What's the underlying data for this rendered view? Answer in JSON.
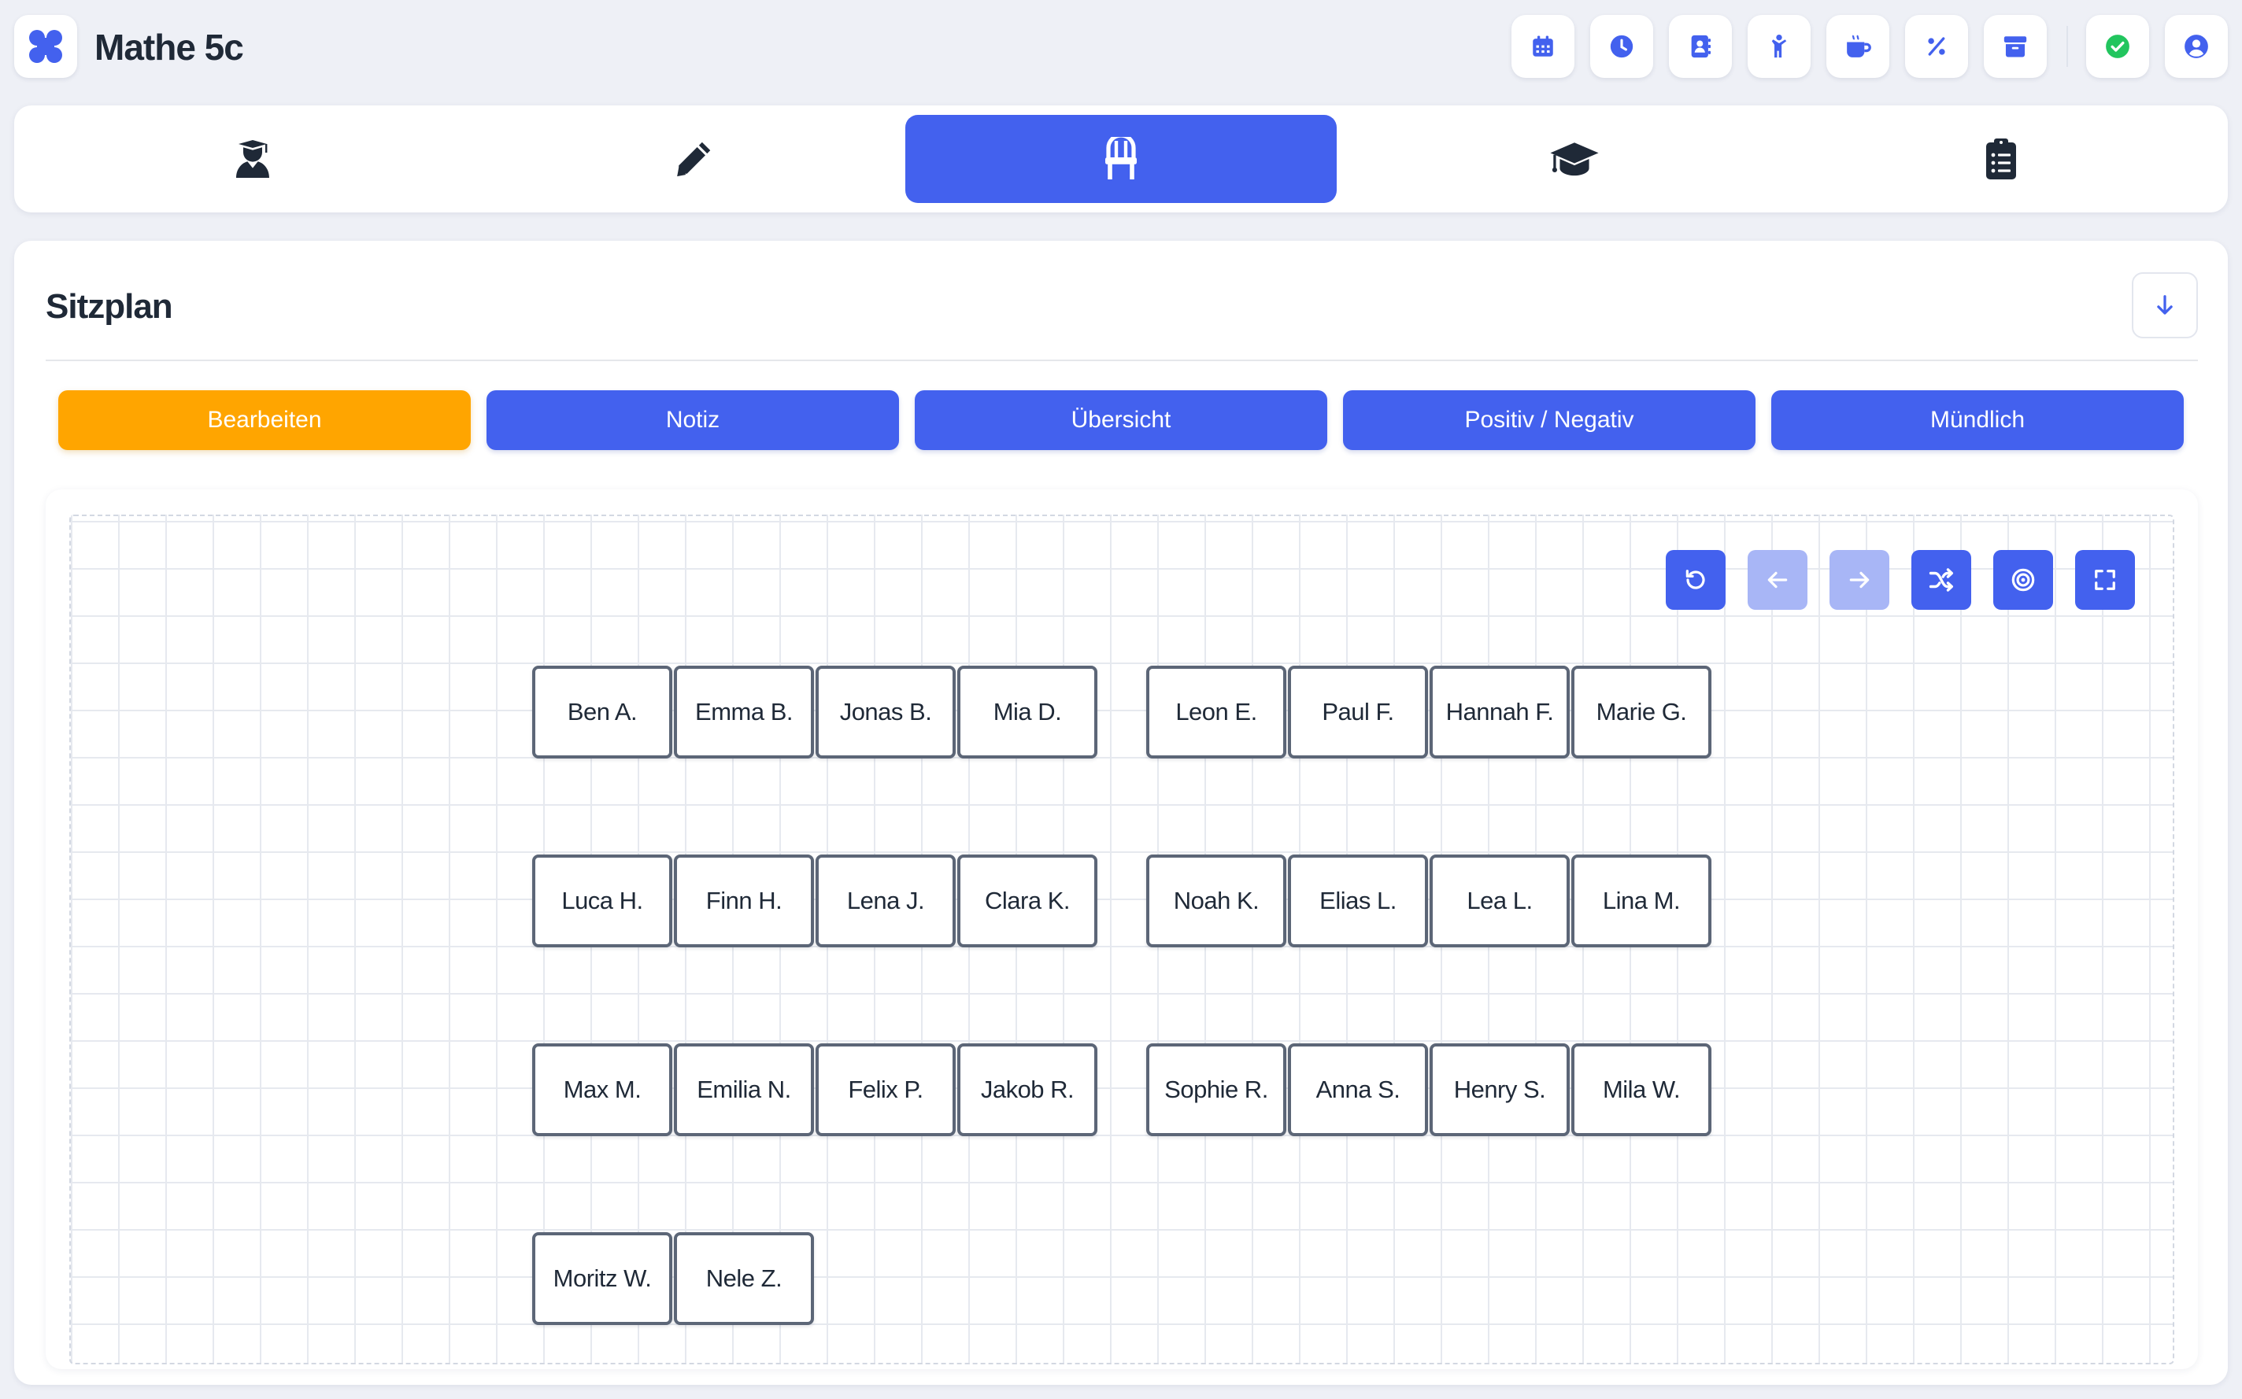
{
  "app": {
    "title": "Mathe 5c"
  },
  "header_buttons": [
    {
      "name": "calendar-button",
      "icon": "calendar-icon"
    },
    {
      "name": "clock-button",
      "icon": "clock-icon"
    },
    {
      "name": "contacts-button",
      "icon": "address-book-icon"
    },
    {
      "name": "child-button",
      "icon": "child-icon"
    },
    {
      "name": "break-button",
      "icon": "coffee-mug-icon"
    },
    {
      "name": "percent-button",
      "icon": "percent-icon"
    },
    {
      "name": "archive-button",
      "icon": "archive-icon"
    },
    {
      "name": "status-button",
      "icon": "check-circle-icon",
      "color": "#22c55e"
    },
    {
      "name": "account-button",
      "icon": "user-circle-icon"
    }
  ],
  "nav_tabs": [
    {
      "icon": "teacher-icon",
      "active": false
    },
    {
      "icon": "pencil-icon",
      "active": false
    },
    {
      "icon": "chair-icon",
      "active": true
    },
    {
      "icon": "graduation-cap-icon",
      "active": false
    },
    {
      "icon": "clipboard-list-icon",
      "active": false
    }
  ],
  "page": {
    "title": "Sitzplan"
  },
  "modes": [
    {
      "label": "Bearbeiten",
      "active": true
    },
    {
      "label": "Notiz",
      "active": false
    },
    {
      "label": "Übersicht",
      "active": false
    },
    {
      "label": "Positiv / Negativ",
      "active": false
    },
    {
      "label": "Mündlich",
      "active": false
    }
  ],
  "toolbar": [
    {
      "name": "reset-button",
      "icon": "rotate-ccw-icon",
      "enabled": true
    },
    {
      "name": "undo-button",
      "icon": "arrow-left-icon",
      "enabled": false
    },
    {
      "name": "redo-button",
      "icon": "arrow-right-icon",
      "enabled": false
    },
    {
      "name": "shuffle-button",
      "icon": "shuffle-icon",
      "enabled": true
    },
    {
      "name": "target-button",
      "icon": "target-icon",
      "enabled": true
    },
    {
      "name": "fullscreen-button",
      "icon": "expand-icon",
      "enabled": true
    }
  ],
  "seat_rows": [
    [
      "Ben A.",
      "Emma B.",
      "Jonas B.",
      "Mia D.",
      "Leon E.",
      "Paul F.",
      "Hannah F.",
      "Marie G."
    ],
    [
      "Luca H.",
      "Finn H.",
      "Lena J.",
      "Clara K.",
      "Noah K.",
      "Elias L.",
      "Lea L.",
      "Lina M."
    ],
    [
      "Max M.",
      "Emilia N.",
      "Felix P.",
      "Jakob R.",
      "Sophie R.",
      "Anna S.",
      "Henry S.",
      "Mila W."
    ],
    [
      "Moritz W.",
      "Nele Z."
    ]
  ],
  "colors": {
    "primary": "#4361ee",
    "active_mode": "#ffa500",
    "disabled_tool": "#a8b6f6",
    "background": "#eef0f6",
    "text": "#1f2937"
  }
}
